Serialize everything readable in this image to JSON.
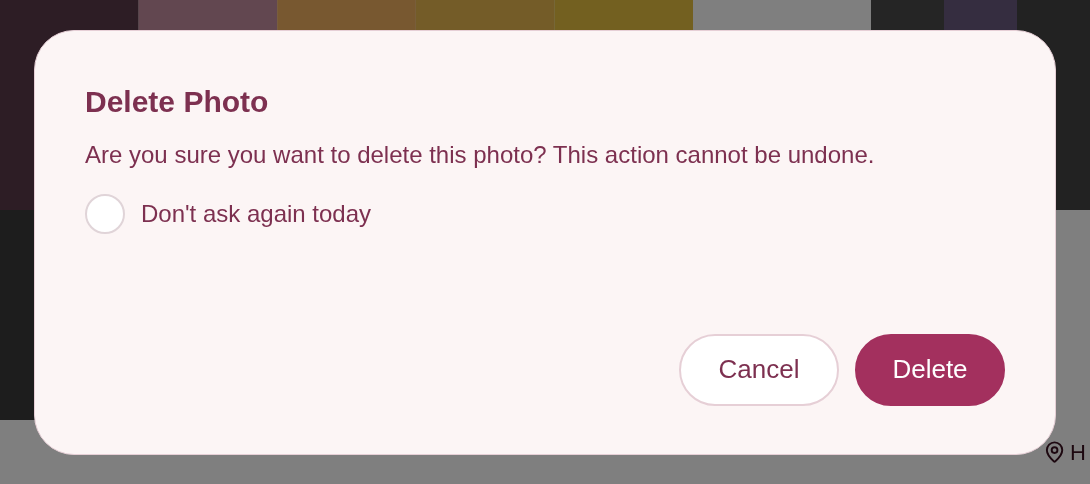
{
  "background": {
    "cards": [
      {
        "kind": "venue"
      },
      {
        "kind": "event",
        "location": "H"
      }
    ]
  },
  "dialog": {
    "title": "Delete Photo",
    "message": "Are you sure you want to delete this photo? This action cannot be undone.",
    "checkbox": {
      "label": "Don't ask again today",
      "checked": false
    },
    "buttons": [
      {
        "label": "Cancel",
        "kind": "secondary"
      },
      {
        "label": "Delete",
        "kind": "danger"
      }
    ]
  }
}
